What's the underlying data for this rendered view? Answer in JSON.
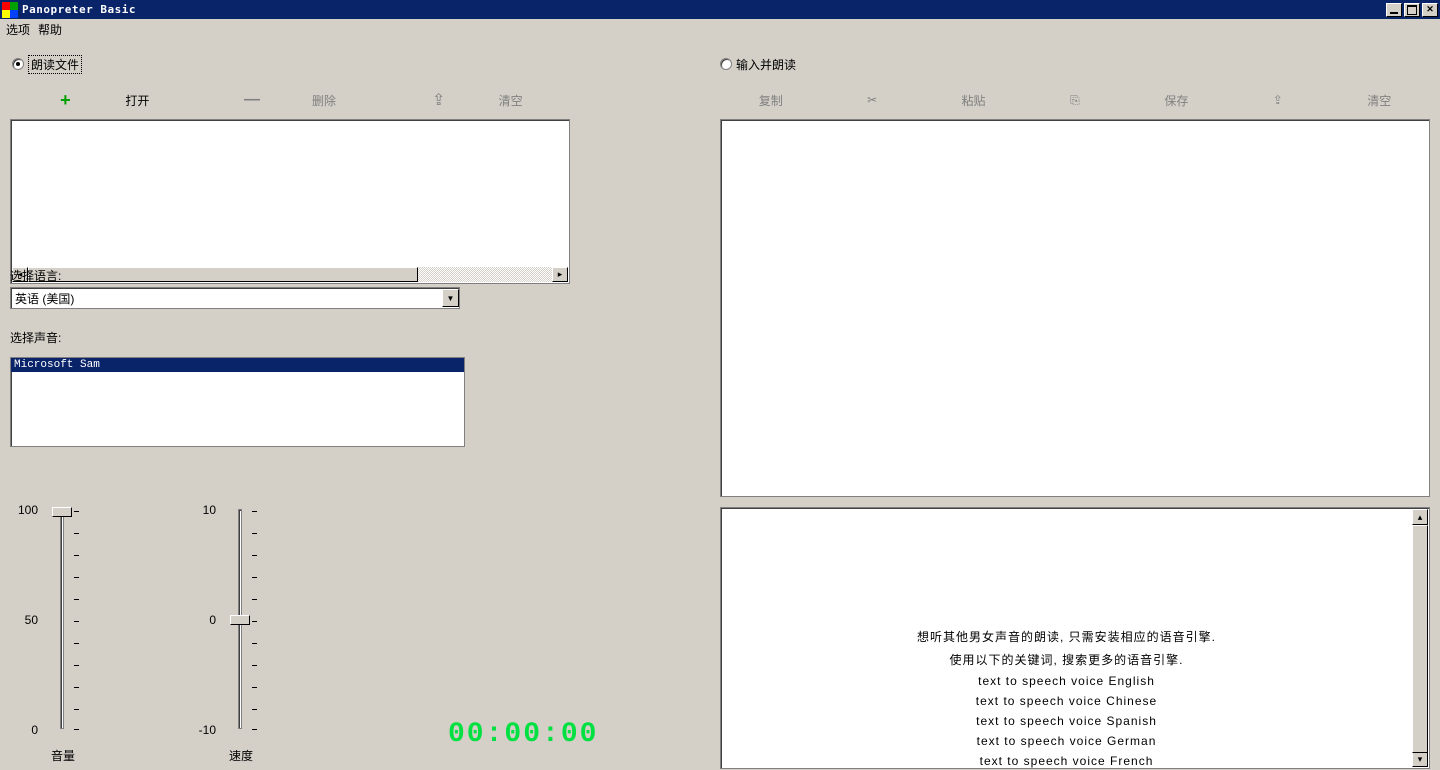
{
  "window": {
    "title": "Panopreter Basic"
  },
  "menu": {
    "options": "选项",
    "help": "帮助"
  },
  "modes": {
    "read_files": "朗读文件",
    "type_and_read": "输入并朗读"
  },
  "left_toolbar": {
    "open": "打开",
    "delete": "删除",
    "clear": "清空"
  },
  "right_toolbar": {
    "copy": "复制",
    "paste": "粘贴",
    "save": "保存",
    "clear": "清空"
  },
  "labels": {
    "choose_language": "选择语言:",
    "choose_voice": "选择声音:",
    "volume": "音量",
    "speed": "速度"
  },
  "language_combo": {
    "selected": "英语 (美国)"
  },
  "voice_list": {
    "items": [
      "Microsoft Sam"
    ]
  },
  "sliders": {
    "volume": {
      "max": "100",
      "mid": "50",
      "min": "0"
    },
    "speed": {
      "max": "10",
      "mid": "0",
      "min": "-10"
    }
  },
  "timer": "00:00:00",
  "info_panel": {
    "line1": "想听其他男女声音的朗读, 只需安装相应的语音引擎.",
    "line2": "使用以下的关键词, 搜索更多的语音引擎.",
    "k1": "text to speech voice English",
    "k2": "text to speech voice Chinese",
    "k3": "text to speech voice Spanish",
    "k4": "text to speech voice German",
    "k5": "text to speech voice French"
  }
}
